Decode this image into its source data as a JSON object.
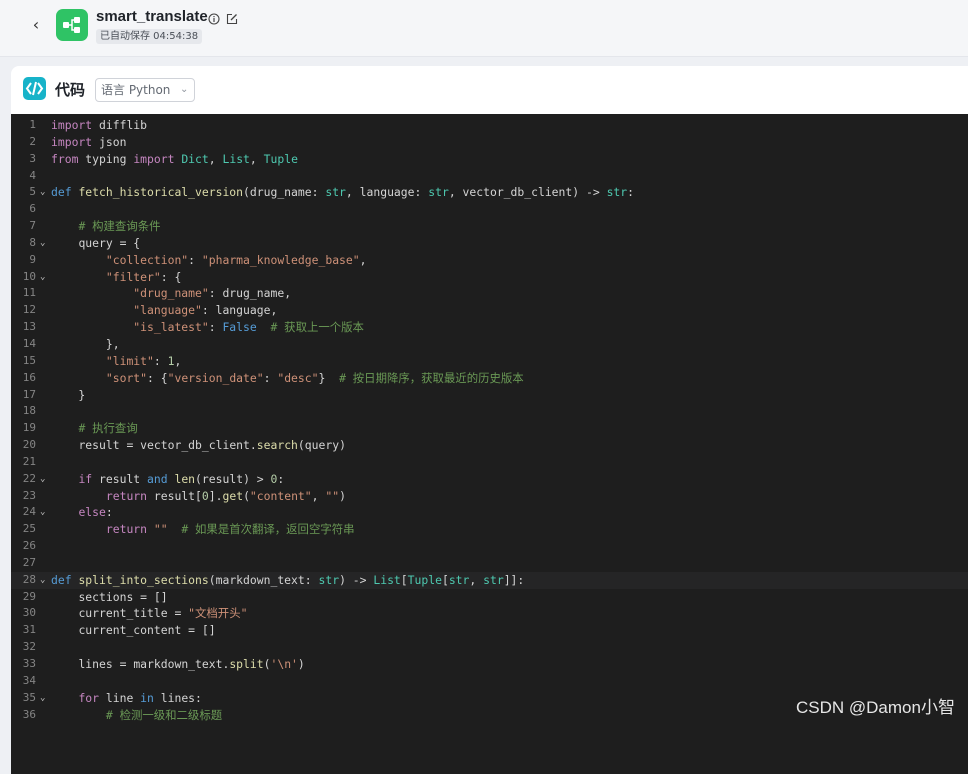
{
  "header": {
    "back_label": "‹",
    "app_icon": "workflow-icon",
    "app_title": "smart_translate",
    "autosave_text": "已自动保存 04:54:38"
  },
  "card": {
    "title": "代码",
    "language_label": "语言 Python",
    "icon": "code-icon"
  },
  "colors": {
    "keyword": "#569cd6",
    "control": "#c586c0",
    "string": "#ce9178",
    "comment": "#6a9955",
    "function": "#dcdcaa",
    "text": "#d4d4d4",
    "number": "#b5cea8",
    "type": "#4ec9b0",
    "variable": "#9cdcfe"
  },
  "editor": {
    "current_line": 28,
    "lines": [
      {
        "n": "1",
        "fold": "",
        "code": "import difflib"
      },
      {
        "n": "2",
        "fold": "",
        "code": "import json"
      },
      {
        "n": "3",
        "fold": "",
        "code": "from typing import Dict, List, Tuple"
      },
      {
        "n": "4",
        "fold": "",
        "code": ""
      },
      {
        "n": "5",
        "fold": "v",
        "code": "def fetch_historical_version(drug_name: str, language: str, vector_db_client) -> str:"
      },
      {
        "n": "6",
        "fold": "",
        "code": ""
      },
      {
        "n": "7",
        "fold": "",
        "code": "    # 构建查询条件"
      },
      {
        "n": "8",
        "fold": "v",
        "code": "    query = {"
      },
      {
        "n": "9",
        "fold": "",
        "code": "        \"collection\": \"pharma_knowledge_base\","
      },
      {
        "n": "10",
        "fold": "v",
        "code": "        \"filter\": {"
      },
      {
        "n": "11",
        "fold": "",
        "code": "            \"drug_name\": drug_name,"
      },
      {
        "n": "12",
        "fold": "",
        "code": "            \"language\": language,"
      },
      {
        "n": "13",
        "fold": "",
        "code": "            \"is_latest\": False  # 获取上一个版本"
      },
      {
        "n": "14",
        "fold": "",
        "code": "        },"
      },
      {
        "n": "15",
        "fold": "",
        "code": "        \"limit\": 1,"
      },
      {
        "n": "16",
        "fold": "",
        "code": "        \"sort\": {\"version_date\": \"desc\"}  # 按日期降序，获取最近的历史版本"
      },
      {
        "n": "17",
        "fold": "",
        "code": "    }"
      },
      {
        "n": "18",
        "fold": "",
        "code": ""
      },
      {
        "n": "19",
        "fold": "",
        "code": "    # 执行查询"
      },
      {
        "n": "20",
        "fold": "",
        "code": "    result = vector_db_client.search(query)"
      },
      {
        "n": "21",
        "fold": "",
        "code": ""
      },
      {
        "n": "22",
        "fold": "v",
        "code": "    if result and len(result) > 0:"
      },
      {
        "n": "23",
        "fold": "",
        "code": "        return result[0].get(\"content\", \"\")"
      },
      {
        "n": "24",
        "fold": "v",
        "code": "    else:"
      },
      {
        "n": "25",
        "fold": "",
        "code": "        return \"\"  # 如果是首次翻译，返回空字符串"
      },
      {
        "n": "26",
        "fold": "",
        "code": ""
      },
      {
        "n": "27",
        "fold": "",
        "code": ""
      },
      {
        "n": "28",
        "fold": "v",
        "code": "def split_into_sections(markdown_text: str) -> List[Tuple[str, str]]:"
      },
      {
        "n": "29",
        "fold": "",
        "code": "    sections = []"
      },
      {
        "n": "30",
        "fold": "",
        "code": "    current_title = \"文档开头\""
      },
      {
        "n": "31",
        "fold": "",
        "code": "    current_content = []"
      },
      {
        "n": "32",
        "fold": "",
        "code": ""
      },
      {
        "n": "33",
        "fold": "",
        "code": "    lines = markdown_text.split('\\n')"
      },
      {
        "n": "34",
        "fold": "",
        "code": ""
      },
      {
        "n": "35",
        "fold": "v",
        "code": "    for line in lines:"
      },
      {
        "n": "36",
        "fold": "",
        "code": "        # 检测一级和二级标题"
      }
    ]
  },
  "watermark": "CSDN @Damon小智"
}
